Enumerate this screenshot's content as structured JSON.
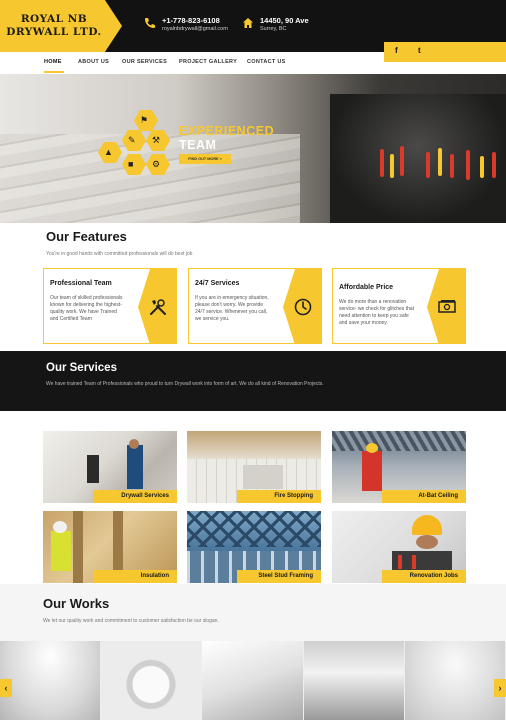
{
  "brand": {
    "line1": "ROYAL NB",
    "line2": "DRYWALL LTD.",
    "accent": "#f7c72f",
    "dark": "#121212"
  },
  "contact": {
    "phone": "+1-778-823-6108",
    "email": "royalnbdrywall@gmail.com",
    "address": "14450, 90 Ave",
    "city": "Surrey, BC"
  },
  "social": {
    "facebook": "f",
    "twitter": "t"
  },
  "nav": [
    {
      "label": "HOME"
    },
    {
      "label": "ABOUT US"
    },
    {
      "label": "OUR SERVICES"
    },
    {
      "label": "PROJECT GALLERY"
    },
    {
      "label": "CONTACT US"
    }
  ],
  "hero": {
    "title_line1": "EXPERIENCED",
    "title_line2": "TEAM",
    "button": "FIND OUT MORE »"
  },
  "features": {
    "title": "Our Features",
    "subtitle": "You're in good hands with committed professionals will do best job",
    "items": [
      {
        "title": "Professional Team",
        "text": "Our team of skilled professionals known for delivering the highest-quality work. We have Trained and Certified Team",
        "icon": "tools-icon"
      },
      {
        "title": "24/7 Services",
        "text": "If you are in emergency situation, please don't worry. We provide 24/7 service. Whenever you call, we service you.",
        "icon": "clock-icon"
      },
      {
        "title": "Affordable Price",
        "text": "We do more than a renovation service- we check for glitches that need attention to keep you safe and save your money.",
        "icon": "money-icon"
      }
    ]
  },
  "services": {
    "title": "Our Services",
    "subtitle": "We have trained Team of Professionals who proud to turn Drywall work into form of art. We do all kind of Renovation Projects.",
    "items": [
      {
        "label": "Drywall Services"
      },
      {
        "label": "Fire Stopping"
      },
      {
        "label": "At-Bat Ceiling"
      },
      {
        "label": "Insulation"
      },
      {
        "label": "Steel Stud Framing"
      },
      {
        "label": "Renovation Jobs"
      }
    ]
  },
  "works": {
    "title": "Our Works",
    "subtitle": "We let our quality work and commitment to customer satisfaction be our slogan."
  }
}
